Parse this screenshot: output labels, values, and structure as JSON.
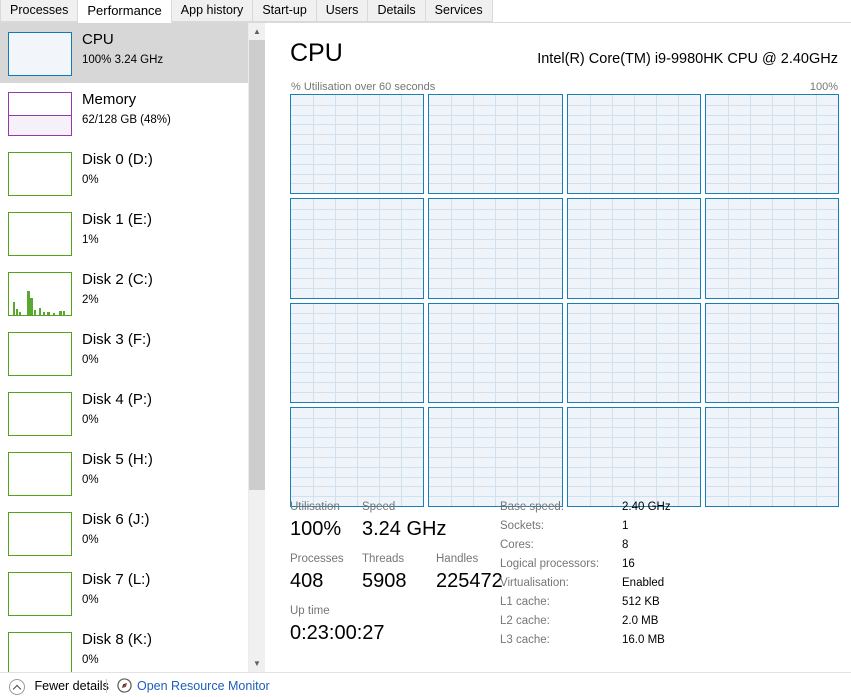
{
  "tabs": [
    {
      "label": "Processes",
      "selected": false
    },
    {
      "label": "Performance",
      "selected": true
    },
    {
      "label": "App history",
      "selected": false
    },
    {
      "label": "Start-up",
      "selected": false
    },
    {
      "label": "Users",
      "selected": false
    },
    {
      "label": "Details",
      "selected": false
    },
    {
      "label": "Services",
      "selected": false
    }
  ],
  "sidebar": {
    "items": [
      {
        "title": "CPU",
        "sub": "100%  3.24 GHz",
        "kind": "cpu",
        "selected": true,
        "fill": 100
      },
      {
        "title": "Memory",
        "sub": "62/128 GB (48%)",
        "kind": "memory",
        "selected": false,
        "fill": 48
      },
      {
        "title": "Disk 0 (D:)",
        "sub": "0%",
        "kind": "disk",
        "selected": false,
        "fill": 0
      },
      {
        "title": "Disk 1 (E:)",
        "sub": "1%",
        "kind": "disk",
        "selected": false,
        "fill": 1
      },
      {
        "title": "Disk 2 (C:)",
        "sub": "2%",
        "kind": "disk",
        "selected": false,
        "fill": 2
      },
      {
        "title": "Disk 3 (F:)",
        "sub": "0%",
        "kind": "disk",
        "selected": false,
        "fill": 0
      },
      {
        "title": "Disk 4 (P:)",
        "sub": "0%",
        "kind": "disk",
        "selected": false,
        "fill": 0
      },
      {
        "title": "Disk 5 (H:)",
        "sub": "0%",
        "kind": "disk",
        "selected": false,
        "fill": 0
      },
      {
        "title": "Disk 6 (J:)",
        "sub": "0%",
        "kind": "disk",
        "selected": false,
        "fill": 0
      },
      {
        "title": "Disk 7 (L:)",
        "sub": "0%",
        "kind": "disk",
        "selected": false,
        "fill": 0
      },
      {
        "title": "Disk 8 (K:)",
        "sub": "0%",
        "kind": "disk",
        "selected": false,
        "fill": 0
      }
    ]
  },
  "main": {
    "heading": "CPU",
    "model": "Intel(R) Core(TM) i9-9980HK CPU @ 2.40GHz",
    "graph_caption": "% Utilisation over 60 seconds",
    "graph_max": "100%",
    "logical_processor_count": 16
  },
  "stats": {
    "utilisation_label": "Utilisation",
    "utilisation_value": "100%",
    "speed_label": "Speed",
    "speed_value": "3.24 GHz",
    "processes_label": "Processes",
    "processes_value": "408",
    "threads_label": "Threads",
    "threads_value": "5908",
    "handles_label": "Handles",
    "handles_value": "225472",
    "uptime_label": "Up time",
    "uptime_value": "0:23:00:27"
  },
  "specs": [
    {
      "label": "Base speed:",
      "value": "2.40 GHz"
    },
    {
      "label": "Sockets:",
      "value": "1"
    },
    {
      "label": "Cores:",
      "value": "8"
    },
    {
      "label": "Logical processors:",
      "value": "16"
    },
    {
      "label": "Virtualisation:",
      "value": "Enabled"
    },
    {
      "label": "L1 cache:",
      "value": "512 KB"
    },
    {
      "label": "L2 cache:",
      "value": "2.0 MB"
    },
    {
      "label": "L3 cache:",
      "value": "16.0 MB"
    }
  ],
  "statusbar": {
    "fewer_details": "Fewer details",
    "open_resource_monitor": "Open Resource Monitor"
  },
  "colors": {
    "cpu_accent": "#1a7fb5",
    "cpu_fill": "#eff4fa",
    "memory_accent": "#8e3cad",
    "disk_accent": "#53a318",
    "link": "#1e5fbe",
    "selected_row": "#d7d7d7"
  }
}
